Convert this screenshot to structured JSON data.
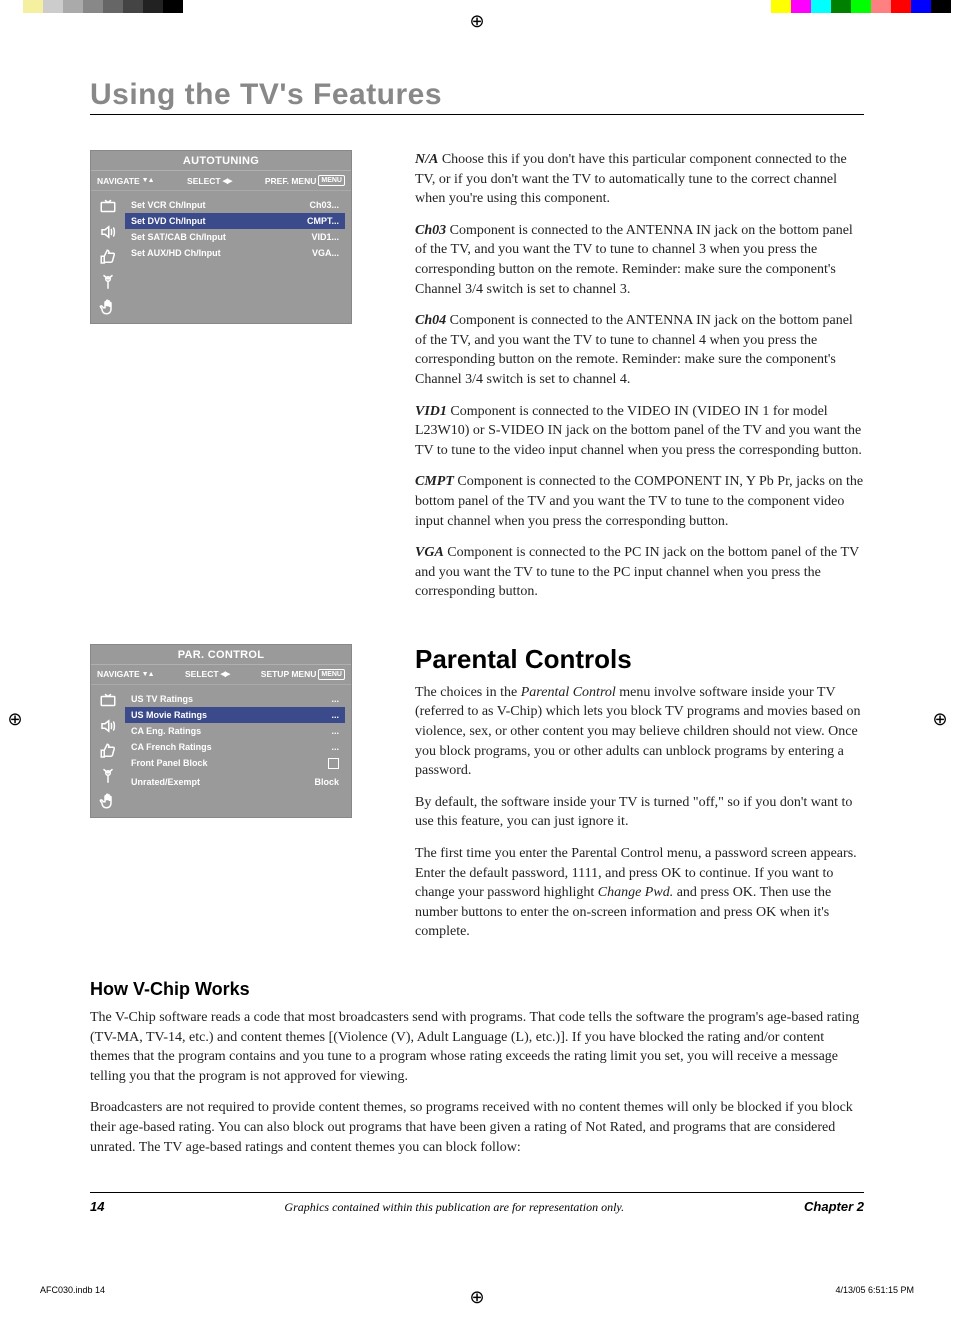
{
  "section_title": "Using the TV's Features",
  "osd1": {
    "title": "AUTOTUNING",
    "nav": "NAVIGATE",
    "select": "SELECT",
    "right_label": "PREF. MENU",
    "menu_tag": "MENU",
    "rows": [
      {
        "label": "Set VCR Ch/Input",
        "value": "Ch03...",
        "selected": false
      },
      {
        "label": "Set DVD Ch/Input",
        "value": "CMPT...",
        "selected": true
      },
      {
        "label": "Set SAT/CAB Ch/Input",
        "value": "VID1...",
        "selected": false
      },
      {
        "label": "Set AUX/HD Ch/Input",
        "value": "VGA...",
        "selected": false
      }
    ]
  },
  "defs": {
    "na_term": "N/A",
    "na_text": "  Choose this if you don't have this particular component connected to the TV, or if you don't want the TV to automatically tune to the correct channel when you're using this component.",
    "ch03_term": "Ch03",
    "ch03_text": "  Component is connected to the ANTENNA IN jack on the bottom panel of the TV, and you want the TV to tune to channel 3 when you press the corresponding button on the remote. Reminder: make sure the component's Channel 3/4 switch is set to channel 3.",
    "ch04_term": "Ch04",
    "ch04_text": "  Component is connected to the ANTENNA IN jack on the bottom panel of the TV, and you want the TV to tune to channel 4 when you press the corresponding button on the remote. Reminder: make sure the component's Channel 3/4 switch is set to channel 4.",
    "vid1_term": "VID1",
    "vid1_text": "   Component is connected to the VIDEO IN (VIDEO IN 1 for model L23W10) or S-VIDEO IN jack on the bottom panel of the TV and you want the TV to tune to the video input channel when you press the corresponding button.",
    "cmpt_term": "CMPT",
    "cmpt_text": "   Component is connected to the COMPONENT IN, Y Pb Pr,  jacks on the bottom panel of the TV and you want the TV to tune to the component video input channel when you press the corresponding button.",
    "vga_term": "VGA",
    "vga_text": "   Component is connected to the PC IN jack on the bottom panel of the TV and you want the TV to tune to the PC input channel when you press the corresponding button."
  },
  "h2_parental": "Parental Controls",
  "parental_p1a": "The choices in the ",
  "parental_p1b": "Parental Control",
  "parental_p1c": " menu involve software inside your TV (referred to as V-Chip) which lets you block TV programs and movies based on violence, sex, or other content you may believe children should not view. Once you block programs, you or other adults can unblock programs by entering a password.",
  "parental_p2": "By default, the software inside your TV is turned \"off,\" so if you don't want to use this feature, you can just ignore it.",
  "parental_p3a": "The first time you enter the Parental Control menu, a password screen appears. Enter the default password, 1111, and press OK to continue. If you want to change your password highlight ",
  "parental_p3b": "Change Pwd.",
  "parental_p3c": " and press OK. Then use the number buttons to enter the on-screen information and press OK when it's complete.",
  "osd2": {
    "title": "PAR. CONTROL",
    "nav": "NAVIGATE",
    "select": "SELECT",
    "right_label": "SETUP MENU",
    "menu_tag": "MENU",
    "rows": [
      {
        "label": "US TV Ratings",
        "value": "...",
        "selected": false
      },
      {
        "label": "US Movie Ratings",
        "value": "...",
        "selected": true
      },
      {
        "label": "CA Eng. Ratings",
        "value": "...",
        "selected": false
      },
      {
        "label": "CA French Ratings",
        "value": "...",
        "selected": false
      },
      {
        "label": "Front Panel Block",
        "value": "",
        "selected": false,
        "checkbox": true
      },
      {
        "label": "Unrated/Exempt",
        "value": "Block",
        "selected": false
      }
    ]
  },
  "h3_vchip": "How V-Chip Works",
  "vchip_p1": "The V-Chip software reads a code that most broadcasters send with programs. That code tells the software the program's age-based rating (TV-MA, TV-14, etc.) and content themes [(Violence (V), Adult Language (L), etc.)]. If you have blocked the rating and/or content themes that the program contains and you tune to a program whose rating exceeds the rating limit you set, you will receive a message telling you that the program is not approved for viewing.",
  "vchip_p2": "Broadcasters are not required to provide content themes, so programs received with no content themes will only be blocked if you block their age-based rating. You can also block out programs that have been given a rating of Not Rated, and programs that are considered unrated. The TV age-based ratings and content themes you can block follow:",
  "footer": {
    "page": "14",
    "note": "Graphics contained within this publication are for representation only.",
    "chapter": "Chapter 2"
  },
  "crop": {
    "file": "AFC030.indb   14",
    "date": "4/13/05   6:51:15 PM"
  },
  "colorbar_left": [
    "#fff",
    "#f5f0a0",
    "#ccc",
    "#aaa",
    "#888",
    "#666",
    "#444",
    "#222",
    "#000"
  ],
  "colorbar_right": [
    "#ffff00",
    "#ff00ff",
    "#00ffff",
    "#008000",
    "#00ff00",
    "#ff8080",
    "#ff0000",
    "#0000ff",
    "#000"
  ]
}
